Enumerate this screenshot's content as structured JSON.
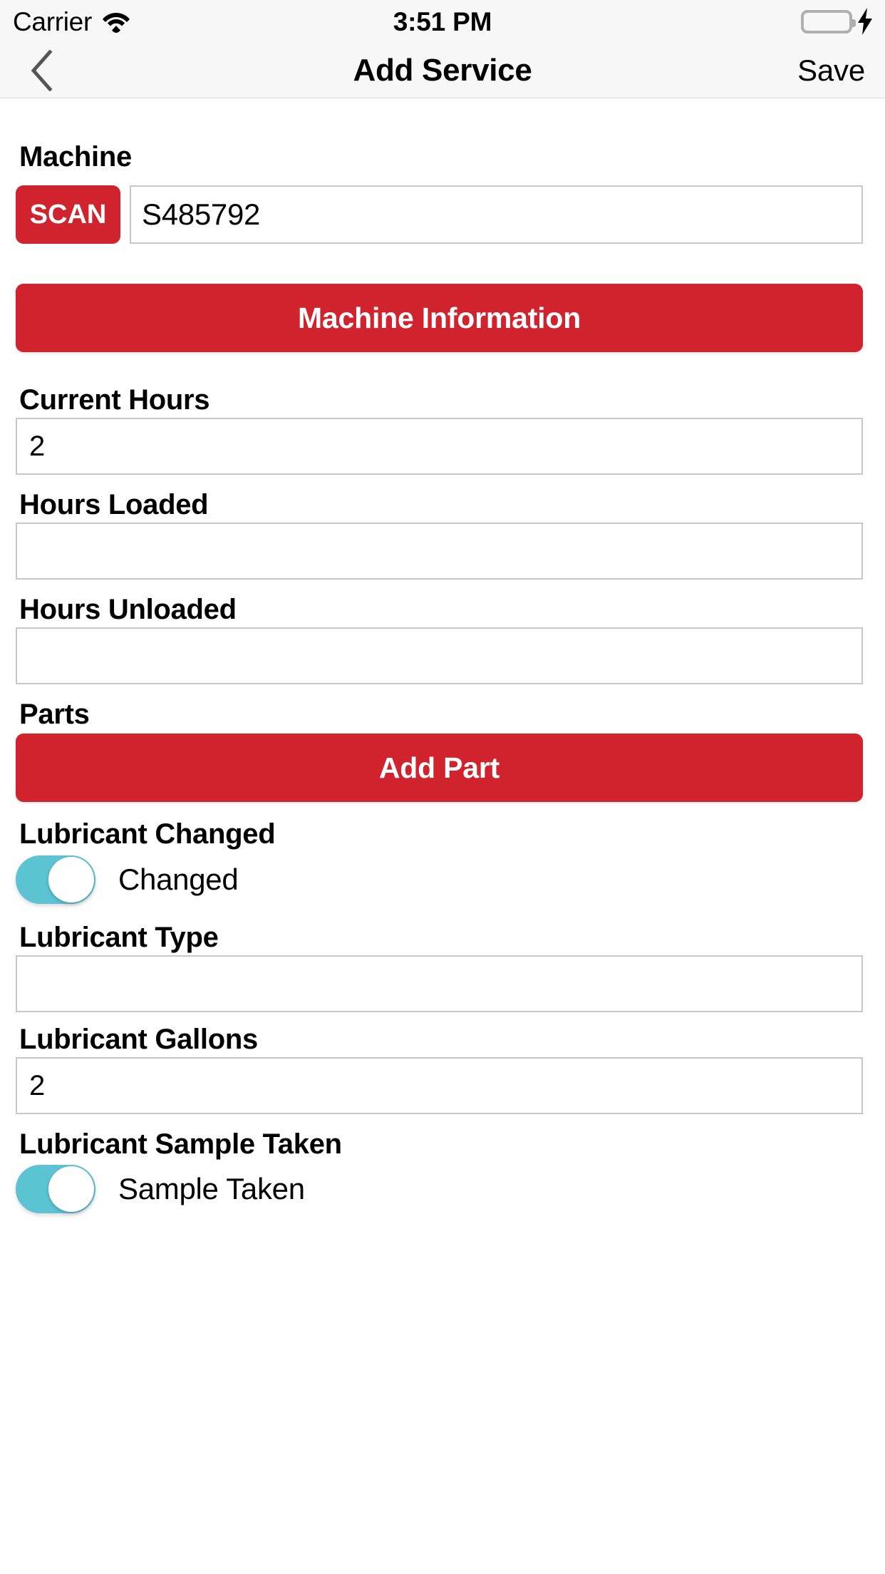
{
  "status_bar": {
    "carrier": "Carrier",
    "wifi_icon": "wifi-icon",
    "time": "3:51 PM",
    "battery_icon": "battery-icon",
    "battery_color": "#4CD964",
    "charging_icon": "lightning-bolt-icon"
  },
  "nav_bar": {
    "back_icon": "chevron-left-icon",
    "title": "Add Service",
    "save_label": "Save"
  },
  "theme": {
    "accent_red": "#D0232E",
    "toggle_on": "#5CC3D2",
    "nav_background": "#F7F7F7",
    "field_border": "#C8C8C8",
    "text_color": "#000000"
  },
  "form": {
    "machine": {
      "label": "Machine",
      "scan_label": "SCAN",
      "value": "S485792",
      "placeholder": "",
      "info_button_label": "Machine Information"
    },
    "current_hours": {
      "label": "Current Hours",
      "value": "2",
      "placeholder": ""
    },
    "hours_loaded": {
      "label": "Hours Loaded",
      "value": "",
      "placeholder": ""
    },
    "hours_unloaded": {
      "label": "Hours Unloaded",
      "value": "",
      "placeholder": ""
    },
    "parts": {
      "label": "Parts",
      "add_part_label": "Add Part"
    },
    "lubricant_changed": {
      "label": "Lubricant Changed",
      "toggle_state": "on",
      "toggle_text": "Changed"
    },
    "lubricant_type": {
      "label": "Lubricant Type",
      "value": "",
      "placeholder": ""
    },
    "lubricant_gallons": {
      "label": "Lubricant Gallons",
      "value": "2",
      "placeholder": ""
    },
    "lubricant_sample_taken": {
      "label": "Lubricant Sample Taken",
      "toggle_state": "on",
      "toggle_text": "Sample Taken"
    }
  }
}
